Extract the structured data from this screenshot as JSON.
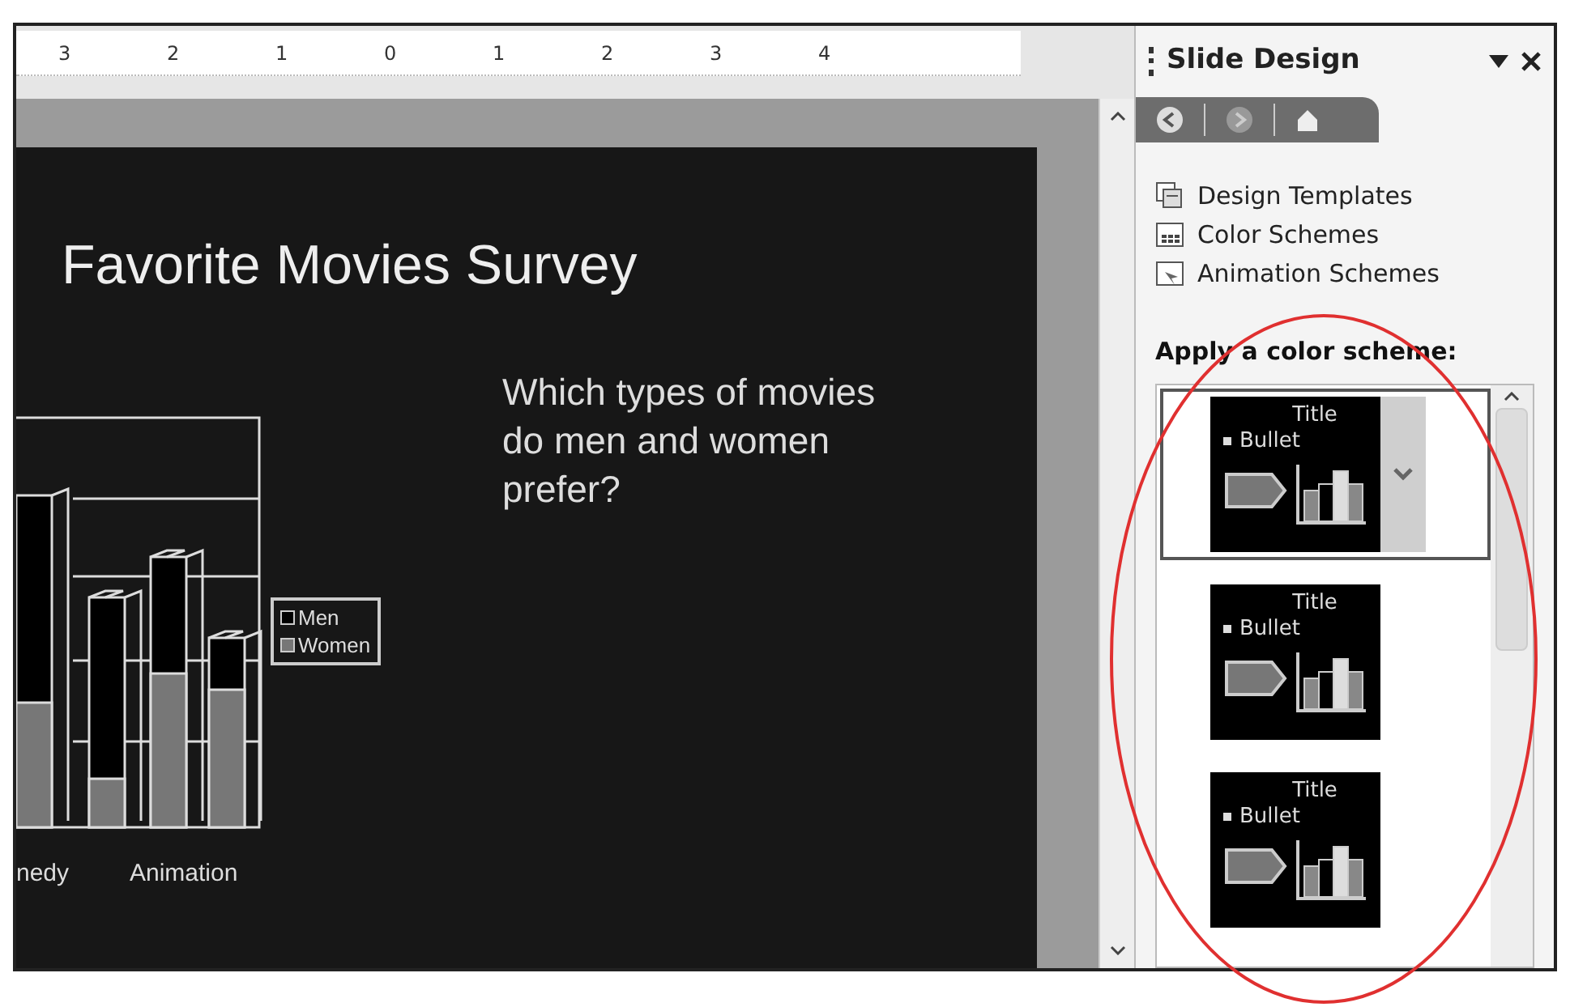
{
  "ruler": {
    "labels": [
      "3",
      "2",
      "1",
      "0",
      "1",
      "2",
      "3",
      "4"
    ]
  },
  "slide": {
    "title": "Favorite Movies Survey",
    "body": "Which types of movies do men and women prefer?",
    "chart": {
      "categories": [
        "nedy",
        "Animation"
      ],
      "legend": [
        "Men",
        "Women"
      ]
    }
  },
  "task_pane": {
    "title": "Slide Design",
    "links": [
      {
        "label": "Design Templates",
        "kind": "templates"
      },
      {
        "label": "Color Schemes",
        "kind": "colors"
      },
      {
        "label": "Animation Schemes",
        "kind": "animation"
      }
    ],
    "heading": "Apply a color scheme:",
    "schemes": [
      {
        "title": "Title",
        "bullet": "Bullet",
        "selected": true
      },
      {
        "title": "Title",
        "bullet": "Bullet",
        "selected": false
      },
      {
        "title": "Title",
        "bullet": "Bullet",
        "selected": false
      }
    ]
  }
}
